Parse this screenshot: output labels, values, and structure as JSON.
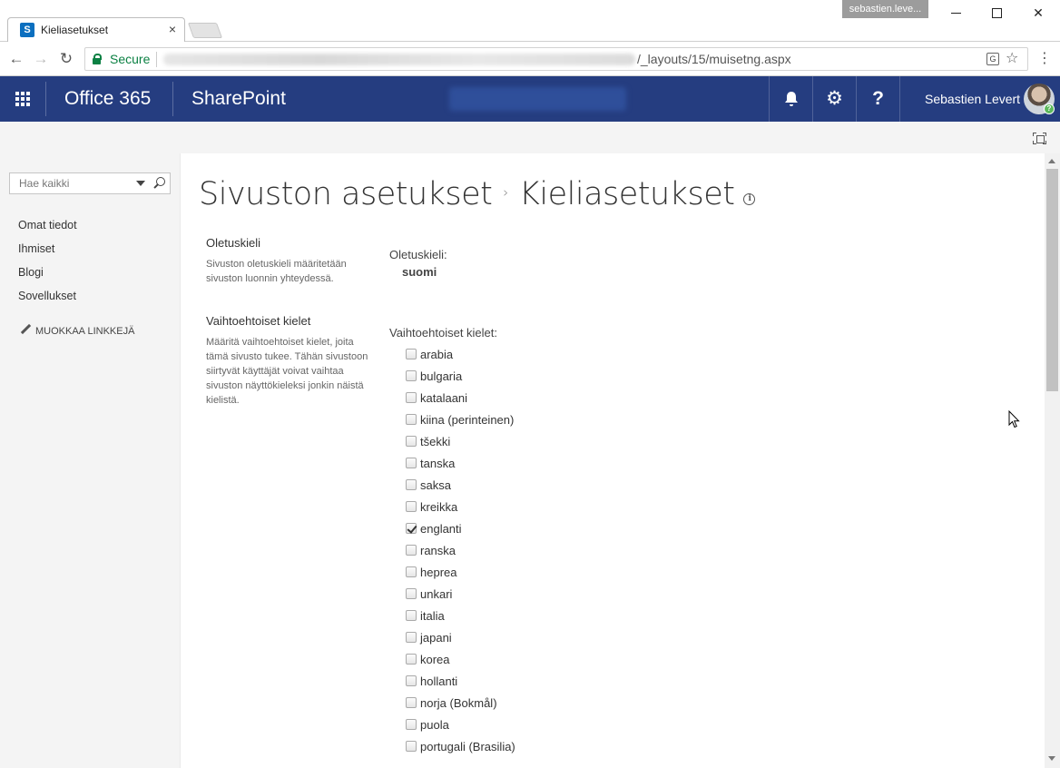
{
  "browser": {
    "tab_title": "Kieliasetukset",
    "tab_close": "×",
    "profile": "sebastien.leve...",
    "secure_label": "Secure",
    "url_visible": "/_layouts/15/muisetng.aspx"
  },
  "suitebar": {
    "brand": "Office 365",
    "app": "SharePoint",
    "help": "?",
    "user_name": "Sebastien Levert",
    "presence": "?"
  },
  "leftnav": {
    "search_placeholder": "Hae kaikki",
    "items": [
      {
        "label": "Omat tiedot"
      },
      {
        "label": "Ihmiset"
      },
      {
        "label": "Blogi"
      },
      {
        "label": "Sovellukset"
      }
    ],
    "edit_links": "MUOKKAA LINKKEJÄ"
  },
  "page": {
    "breadcrumb_parent": "Sivuston asetukset",
    "breadcrumb_sep": "›",
    "title": "Kieliasetukset",
    "info": "i",
    "default_section": {
      "heading": "Oletuskieli",
      "description": "Sivuston oletuskieli määritetään sivuston luonnin yhteydessä.",
      "field_label": "Oletuskieli:",
      "value": "suomi"
    },
    "alt_section": {
      "heading": "Vaihtoehtoiset kielet",
      "description": "Määritä vaihtoehtoiset kielet, joita tämä sivusto tukee. Tähän sivustoon siirtyvät käyttäjät voivat vaihtaa sivuston näyttökieleksi jonkin näistä kielistä.",
      "field_label": "Vaihtoehtoiset kielet:"
    },
    "languages": [
      {
        "label": "arabia",
        "checked": false
      },
      {
        "label": "bulgaria",
        "checked": false
      },
      {
        "label": "katalaani",
        "checked": false
      },
      {
        "label": "kiina (perinteinen)",
        "checked": false
      },
      {
        "label": "tšekki",
        "checked": false
      },
      {
        "label": "tanska",
        "checked": false
      },
      {
        "label": "saksa",
        "checked": false
      },
      {
        "label": "kreikka",
        "checked": false
      },
      {
        "label": "englanti",
        "checked": true
      },
      {
        "label": "ranska",
        "checked": false
      },
      {
        "label": "heprea",
        "checked": false
      },
      {
        "label": "unkari",
        "checked": false
      },
      {
        "label": "italia",
        "checked": false
      },
      {
        "label": "japani",
        "checked": false
      },
      {
        "label": "korea",
        "checked": false
      },
      {
        "label": "hollanti",
        "checked": false
      },
      {
        "label": "norja (Bokmål)",
        "checked": false
      },
      {
        "label": "puola",
        "checked": false
      },
      {
        "label": "portugali (Brasilia)",
        "checked": false
      }
    ]
  }
}
